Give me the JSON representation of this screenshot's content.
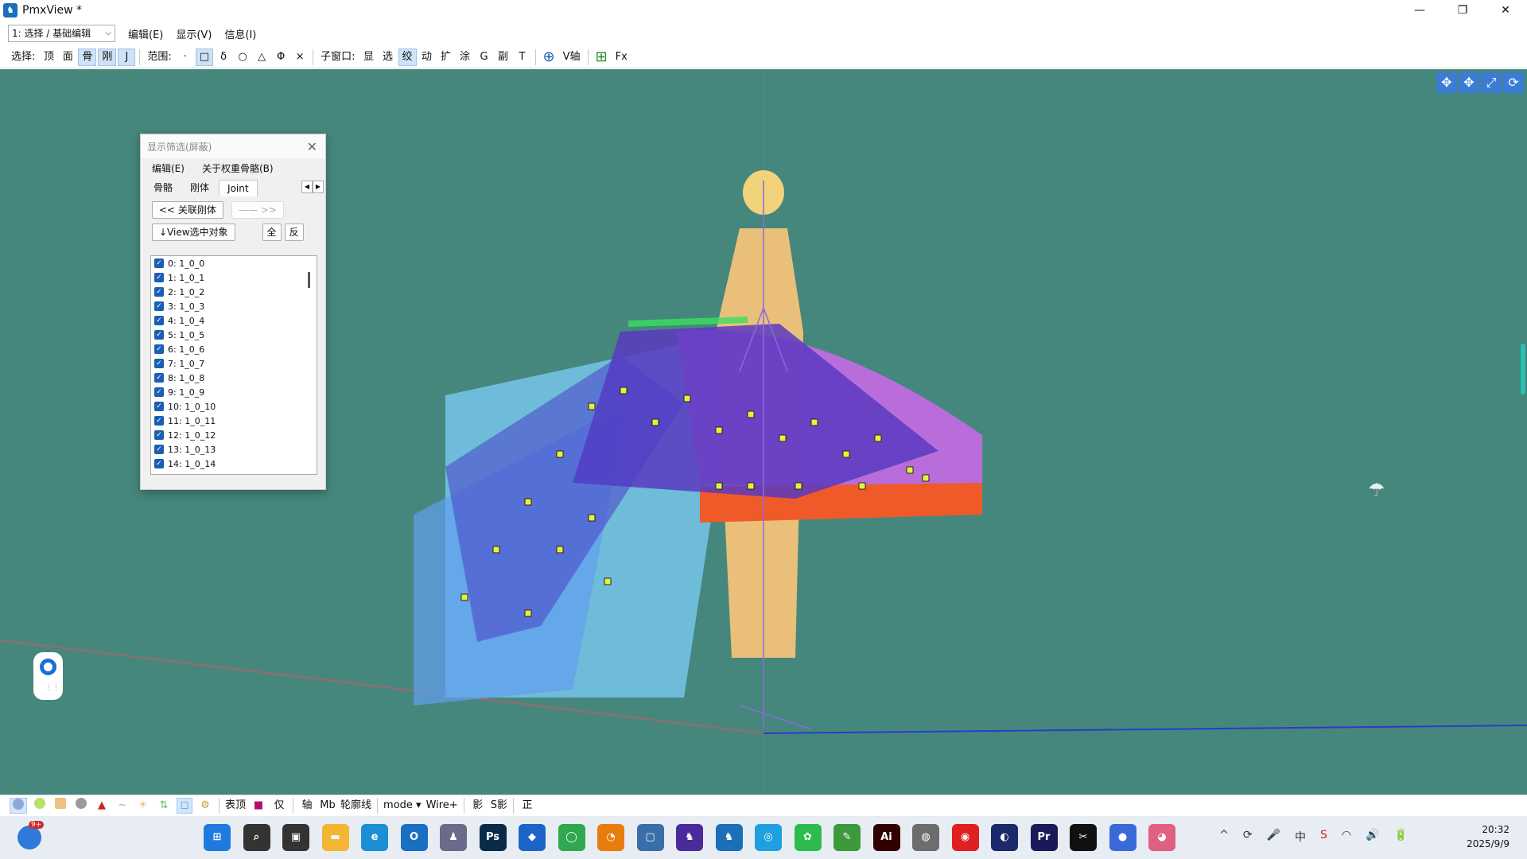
{
  "window": {
    "title": "PmxView *"
  },
  "menubar": {
    "mode_combo": "1: 选择 / 基础编辑",
    "items": [
      "编辑(E)",
      "显示(V)",
      "信息(I)"
    ]
  },
  "toolbar": {
    "select_label": "选择:",
    "select_items": [
      "顶",
      "面",
      "骨",
      "刚",
      "J"
    ],
    "range_label": "范围:",
    "range_items": [
      "·",
      "□",
      "δ",
      "○",
      "△",
      "Φ",
      "×"
    ],
    "subwindow_label": "子窗口:",
    "subwindow_items": [
      "显",
      "选",
      "绞",
      "动",
      "扩",
      "涂",
      "G",
      "副",
      "T"
    ],
    "axis_label": "V轴",
    "fx_label": "Fx"
  },
  "viewport": {
    "corner_icons": [
      "move-xy",
      "move-xz",
      "zoom",
      "rotate"
    ]
  },
  "dialog": {
    "title": "显示筛选(屏蔽)",
    "menu": [
      "编辑(E)",
      "关于权重骨骼(B)"
    ],
    "tabs": [
      "骨骼",
      "刚体",
      "Joint"
    ],
    "active_tab": "Joint",
    "btn_related": "<< 关联刚体",
    "btn_next": "—— >>",
    "btn_view_select": "↓View选中对象",
    "btn_all": "全",
    "btn_invert": "反",
    "joints": [
      {
        "label": "0:  1_0_0"
      },
      {
        "label": "1:  1_0_1"
      },
      {
        "label": "2:  1_0_2"
      },
      {
        "label": "3:  1_0_3"
      },
      {
        "label": "4:  1_0_4"
      },
      {
        "label": "5:  1_0_5"
      },
      {
        "label": "6:  1_0_6"
      },
      {
        "label": "7:  1_0_7"
      },
      {
        "label": "8:  1_0_8"
      },
      {
        "label": "9:  1_0_9"
      },
      {
        "label": "10:  1_0_10"
      },
      {
        "label": "11:  1_0_11"
      },
      {
        "label": "12:  1_0_12"
      },
      {
        "label": "13:  1_0_13"
      },
      {
        "label": "14:  1_0_14"
      }
    ]
  },
  "statusbar": {
    "items": [
      "表顶",
      "仅",
      "轴",
      "Mb",
      "轮廓线",
      "mode ▾",
      "Wire+",
      "影",
      "S影",
      "正"
    ]
  },
  "taskbar": {
    "weather_badge": "9+",
    "apps": [
      {
        "name": "start",
        "glyph": "⊞",
        "color": "#1f7ae0"
      },
      {
        "name": "search",
        "glyph": "⌕",
        "color": "#333333"
      },
      {
        "name": "task-view",
        "glyph": "▣",
        "color": "#333333"
      },
      {
        "name": "file-explorer",
        "glyph": "▬",
        "color": "#f2b632"
      },
      {
        "name": "edge",
        "glyph": "e",
        "color": "#1b8ed6"
      },
      {
        "name": "outlook",
        "glyph": "O",
        "color": "#1a6fc2"
      },
      {
        "name": "app-character",
        "glyph": "♟",
        "color": "#6a6a8a"
      },
      {
        "name": "photoshop",
        "glyph": "Ps",
        "color": "#0a2a4a"
      },
      {
        "name": "app-blue",
        "glyph": "◆",
        "color": "#1d64c8"
      },
      {
        "name": "app-green",
        "glyph": "◯",
        "color": "#2fa84f"
      },
      {
        "name": "blender",
        "glyph": "◔",
        "color": "#e87d0d"
      },
      {
        "name": "app-window",
        "glyph": "▢",
        "color": "#3a6ea8"
      },
      {
        "name": "pmx-editor",
        "glyph": "♞",
        "color": "#4b2a9a"
      },
      {
        "name": "pmx-view",
        "glyph": "♞",
        "color": "#1b6fb8"
      },
      {
        "name": "app-circle",
        "glyph": "◎",
        "color": "#1ea0e0"
      },
      {
        "name": "wechat",
        "glyph": "✿",
        "color": "#2dbb4e"
      },
      {
        "name": "app-paint",
        "glyph": "✎",
        "color": "#3c9a3c"
      },
      {
        "name": "illustrator",
        "glyph": "Ai",
        "color": "#310000"
      },
      {
        "name": "app-gray",
        "glyph": "◍",
        "color": "#6d6d6d"
      },
      {
        "name": "netease-music",
        "glyph": "◉",
        "color": "#e02020"
      },
      {
        "name": "cinema4d",
        "glyph": "◐",
        "color": "#1a2a6a"
      },
      {
        "name": "premiere",
        "glyph": "Pr",
        "color": "#1a1a5a"
      },
      {
        "name": "capcut",
        "glyph": "✂",
        "color": "#111111"
      },
      {
        "name": "app-ring",
        "glyph": "●",
        "color": "#3a6ad8"
      },
      {
        "name": "app-camera",
        "glyph": "◕",
        "color": "#e06080"
      }
    ],
    "tray": [
      "^",
      "⟳",
      "🎤",
      "中",
      "S",
      "wifi",
      "🔊",
      "🔋"
    ],
    "time": "20:32",
    "date": "2025/9/9"
  }
}
